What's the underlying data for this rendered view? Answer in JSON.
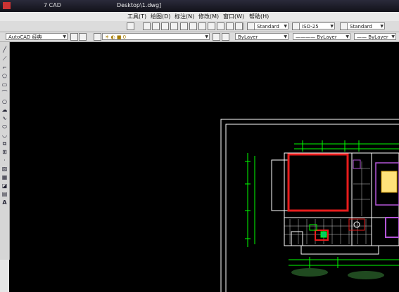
{
  "titlebar": {
    "app_title": "7 CAD",
    "file_title": "Desktop\\1.dwg]"
  },
  "menus": [
    "工具(T)",
    "绘图(D)",
    "标注(N)",
    "修改(M)",
    "窗口(W)",
    "帮助(H)"
  ],
  "styles": {
    "text_style": "Standard",
    "dim_style": "ISO-25",
    "table_style": "Standard"
  },
  "workspace": "AutoCAD 经典",
  "layers": {
    "color": "ByLayer",
    "linetype": "ByLayer",
    "lineweight": "ByLayer"
  },
  "colors": {
    "background": "#000000",
    "walls": "#ffffff",
    "dims": "#00ff00",
    "highlight": "#e81c1c",
    "furniture": "#b455d8",
    "accent": "#ffe27a"
  },
  "icons": {
    "draw_tools": [
      "line-icon",
      "construction-line-icon",
      "polyline-icon",
      "polygon-icon",
      "rectangle-icon",
      "arc-icon",
      "circle-icon",
      "revcloud-icon",
      "spline-icon",
      "ellipse-icon",
      "ellipse-arc-icon",
      "insert-block-icon",
      "make-block-icon",
      "point-icon",
      "hatch-icon",
      "gradient-icon",
      "region-icon",
      "table-icon",
      "mtext-icon"
    ]
  }
}
